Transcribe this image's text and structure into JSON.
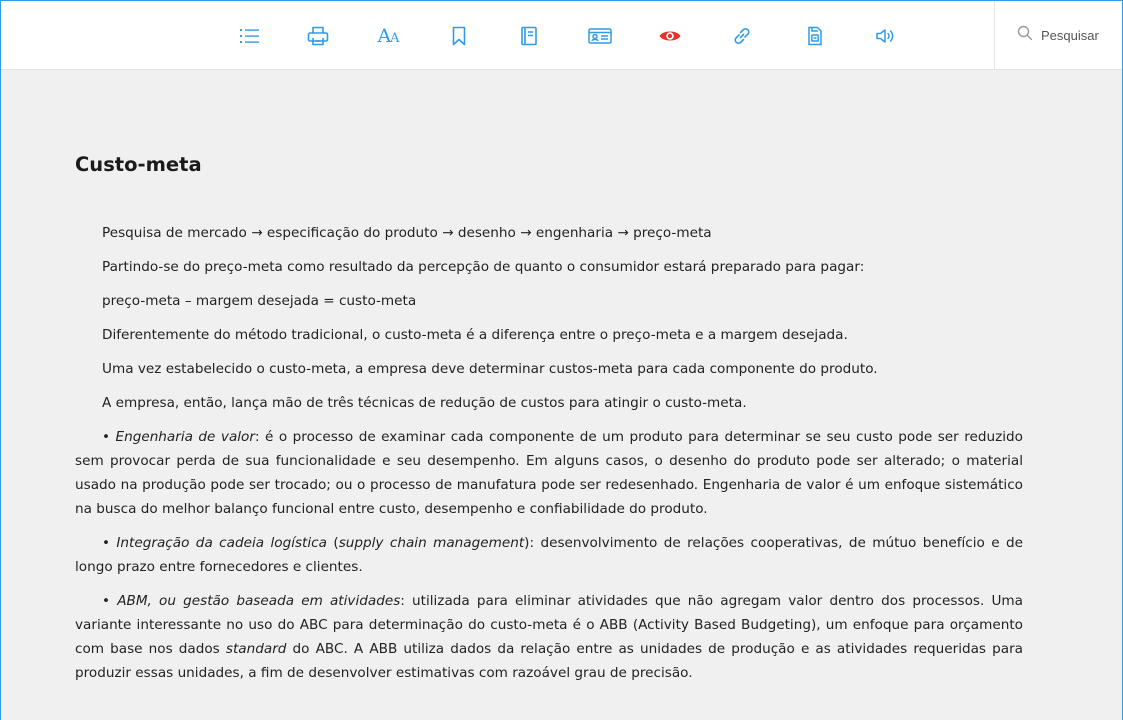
{
  "toolbar": {
    "items": [
      {
        "name": "list-icon"
      },
      {
        "name": "print-icon"
      },
      {
        "name": "font-size-icon",
        "glyph": "AA"
      },
      {
        "name": "bookmark-icon"
      },
      {
        "name": "notebook-icon"
      },
      {
        "name": "id-card-icon"
      },
      {
        "name": "eye-icon",
        "color": "#e8312c",
        "active": true
      },
      {
        "name": "link-icon"
      },
      {
        "name": "document-icon"
      },
      {
        "name": "speaker-icon"
      }
    ],
    "icon_color": "#2f9be9",
    "search_label": "Pesquisar"
  },
  "article": {
    "title": "Custo-meta",
    "p1": "Pesquisa de mercado → especificação do produto → desenho → engenharia → preço-meta",
    "p2": "Partindo-se do preço-meta como resultado da percepção de quanto o consumidor estará preparado para pagar:",
    "p3": "preço-meta – margem desejada = custo-meta",
    "p4": "Diferentemente do método tradicional, o custo-meta é a diferença entre o preço-meta e a margem desejada.",
    "p5": "Uma vez estabelecido o custo-meta, a empresa deve determinar custos-meta para cada componente do produto.",
    "p6": "A empresa, então, lança mão de três técnicas de redução de custos para atingir o custo-meta.",
    "b1_bullet": "• ",
    "b1_term": "Engenharia de valor",
    "b1_text": ": é o processo de examinar cada componente de um produto para determinar se seu custo pode ser reduzido sem provocar perda de sua funcionalidade e seu desempenho. Em alguns casos, o desenho do produto pode ser alterado; o material usado na produção pode ser trocado; ou o processo de manufatura pode ser redesenhado. Engenharia de valor é um enfoque sistemático na busca do melhor balanço funcional entre custo, desempenho e confiabilidade do produto.",
    "b2_bullet": "• ",
    "b2_term": "Integração da cadeia logística",
    "b2_mid1": " (",
    "b2_term2": "supply chain management",
    "b2_text": "): desenvolvimento de relações cooperativas, de mútuo benefício e de longo prazo entre fornecedores e clientes.",
    "b3_bullet": "• ",
    "b3_term": "ABM, ou gestão baseada em atividades",
    "b3_text1": ": utilizada para eliminar atividades que não agregam valor dentro dos processos. Uma variante interessante no uso do ABC para determinação do custo-meta é o ABB (Activity Based Budgeting), um enfoque para orçamento com base nos dados ",
    "b3_term2": "standard",
    "b3_text2": " do ABC. A ABB utiliza dados da relação entre as unidades de produção e as atividades requeridas para produzir essas unidades, a fim de desenvolver estimativas com razoável grau de precisão."
  }
}
